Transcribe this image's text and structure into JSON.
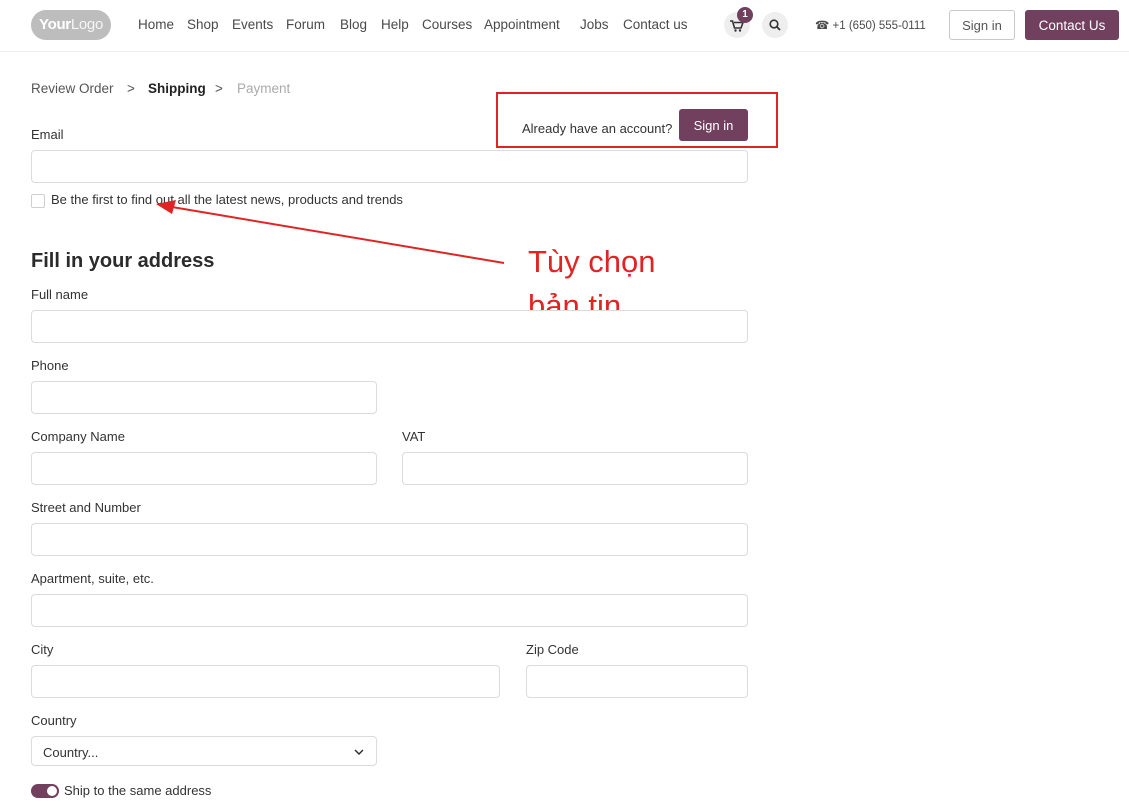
{
  "header": {
    "logo": {
      "bold": "Your",
      "light": "Logo"
    },
    "nav": [
      "Home",
      "Shop",
      "Events",
      "Forum",
      "Blog",
      "Help",
      "Courses",
      "Appointment",
      "Jobs",
      "Contact us"
    ],
    "cart_count": "1",
    "phone": "+1 (650) 555-0111",
    "sign_in": "Sign in",
    "contact": "Contact Us"
  },
  "breadcrumb": {
    "step1": "Review Order",
    "sep": ">",
    "step2": "Shipping",
    "step3": "Payment"
  },
  "account": {
    "prompt": "Already have an account?",
    "sign_in": "Sign in"
  },
  "email": {
    "label": "Email",
    "value": ""
  },
  "newsletter": {
    "label": "Be the first to find out all the latest news, products and trends",
    "checked": false
  },
  "annotation": {
    "line1": "Tùy chọn",
    "line2": "bản tin",
    "color": "#e02424"
  },
  "address": {
    "heading": "Fill in your address",
    "full_name": "Full name",
    "phone": "Phone",
    "company": "Company Name",
    "vat": "VAT",
    "street": "Street and Number",
    "apartment": "Apartment, suite, etc.",
    "city": "City",
    "zip": "Zip Code",
    "country": "Country",
    "country_selected": "Country..."
  },
  "ship_same": {
    "label": "Ship to the same address",
    "on": true
  },
  "colors": {
    "brand": "#71405f",
    "annotation": "#e02424"
  }
}
